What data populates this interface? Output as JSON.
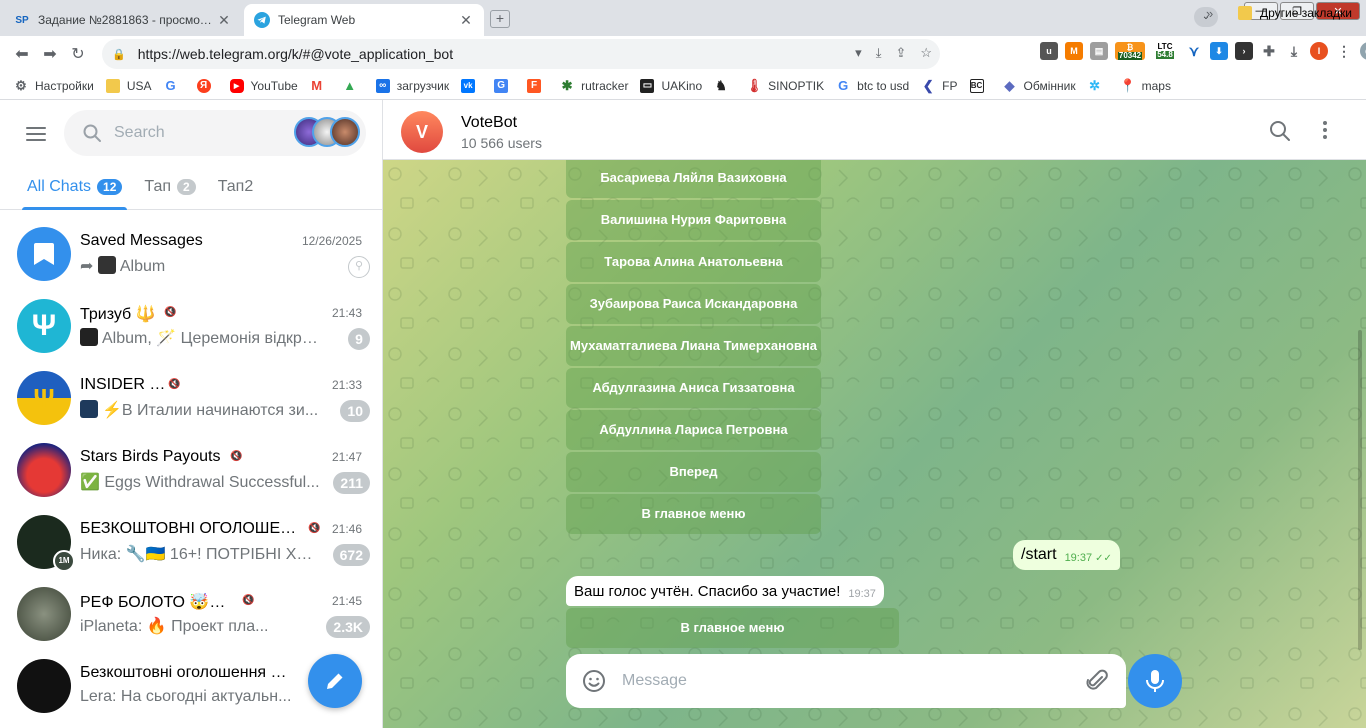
{
  "browser": {
    "tabs": [
      {
        "title": "Задание №2881863 - просмотр з",
        "favicon": "SP",
        "active": false
      },
      {
        "title": "Telegram Web",
        "favicon": "telegram-icon",
        "active": true
      }
    ],
    "url": "https://web.telegram.org/k/#@vote_application_bot",
    "ext_ltc_label": "LTC",
    "ext_count_1": "70342",
    "ext_count_2": "54.8",
    "profile_letter": "I",
    "bookmarks": [
      {
        "label": "Настройки",
        "icon": "gear-icon",
        "color": "#5f6368"
      },
      {
        "label": "USA",
        "icon": "folder-icon",
        "color": "#f2c94c"
      },
      {
        "label": "",
        "icon": "google-icon",
        "color": "#4285f4"
      },
      {
        "label": "",
        "icon": "yandex-icon",
        "color": "#fc3f1d"
      },
      {
        "label": "YouTube",
        "icon": "youtube-icon",
        "color": "#ff0000"
      },
      {
        "label": "",
        "icon": "gmail-icon",
        "color": "#ea4335"
      },
      {
        "label": "",
        "icon": "drive-icon",
        "color": "#34a853"
      },
      {
        "label": "загрузчик",
        "icon": "infinity-icon",
        "color": "#1a73e8"
      },
      {
        "label": "",
        "icon": "vk-icon",
        "color": "#0077ff"
      },
      {
        "label": "",
        "icon": "translate-icon",
        "color": "#4285f4"
      },
      {
        "label": "",
        "icon": "f-icon",
        "color": "#ff5722"
      },
      {
        "label": "rutracker",
        "icon": "rutracker-icon",
        "color": "#2e7d32"
      },
      {
        "label": "UAKino",
        "icon": "uakino-icon",
        "color": "#222222"
      },
      {
        "label": "",
        "icon": "chess-icon",
        "color": "#222222"
      },
      {
        "label": "SINOPTIK",
        "icon": "thermometer-icon",
        "color": "#d32f2f"
      },
      {
        "label": "btc to usd",
        "icon": "google-icon",
        "color": "#4285f4"
      },
      {
        "label": "FP",
        "icon": "fp-icon",
        "color": "#3949ab"
      },
      {
        "label": "",
        "icon": "bc-icon",
        "color": "#222222"
      },
      {
        "label": "Обмінник",
        "icon": "exchange-icon",
        "color": "#5c6bc0"
      },
      {
        "label": "",
        "icon": "snowflake-icon",
        "color": "#29b6f6"
      },
      {
        "label": "maps",
        "icon": "maps-icon",
        "color": "#34a853"
      }
    ],
    "bookmarks_more": "»",
    "other_bookmarks": "Другие закладки"
  },
  "sidebar": {
    "search_placeholder": "Search",
    "folders": [
      {
        "label": "All Chats",
        "count": "12",
        "active": true
      },
      {
        "label": "Тап",
        "count": "2",
        "active": false
      },
      {
        "label": "Тап2",
        "count": "",
        "active": false
      }
    ],
    "chats": [
      {
        "title": "Saved Messages",
        "time": "12/26/2025",
        "preview": "Album",
        "badge": "",
        "pinned": true,
        "muted": false,
        "avatar_color": "#3390ec"
      },
      {
        "title": "Тризуб 🔱",
        "time": "21:43",
        "preview": "Album, 🪄 Церемонія відкри...",
        "badge": "9",
        "pinned": false,
        "muted": true,
        "avatar_color": "#1fb6d4"
      },
      {
        "title": "INSIDER UA",
        "time": "21:33",
        "preview": "⚡В Италии начинаются зи...",
        "badge": "10",
        "pinned": false,
        "muted": true,
        "avatar_color": "#1f5fbf"
      },
      {
        "title": "Stars Birds Payouts",
        "time": "21:47",
        "preview": "✅ Eggs Withdrawal Successful...",
        "badge": "211",
        "pinned": false,
        "muted": true,
        "avatar_color": "#c62828"
      },
      {
        "title": "БЕЗКОШТОВНІ ОГОЛОШЕН...",
        "time": "21:46",
        "preview": "Ника: 🔧🇺🇦 16+! ПОТРІБНІ ХЛ...",
        "badge": "672",
        "pinned": false,
        "muted": true,
        "avatar_color": "#1b2a1e"
      },
      {
        "title": "РЕФ БОЛОТО 🤯🤯🤯",
        "time": "21:45",
        "preview": "iPlaneta: 🔥 Проект пла...",
        "badge": "2.3K",
        "pinned": false,
        "muted": true,
        "avatar_color": "#5d6a55"
      },
      {
        "title": "Безкоштовні оголошення р...",
        "time": "",
        "preview": "Lera: На сьогодні актуальн...",
        "badge": "",
        "pinned": false,
        "muted": false,
        "avatar_color": "#111111"
      }
    ],
    "avatar_badge_1m": "1M"
  },
  "chat": {
    "title": "VoteBot",
    "subtitle": "10 566 users",
    "avatar_letter": "V",
    "keyboard_buttons": [
      "Басариева Ляйля Вазиховна",
      "Валишина Нурия Фаритовна",
      "Тарова Алина Анатольевна",
      "Зубаирова Раиса Искандаровна",
      "Мухаматгалиева Лиана Тимерхановна",
      "Абдулгазина Аниса Гиззатовна",
      "Абдуллина Лариса Петровна",
      "Вперед",
      "В главное меню"
    ],
    "outgoing": {
      "text": "/start",
      "time": "19:37"
    },
    "incoming": {
      "text": "Ваш голос учтён. Спасибо за участие!",
      "time": "19:37"
    },
    "reply_button": "В главное меню",
    "composer_placeholder": "Message"
  }
}
